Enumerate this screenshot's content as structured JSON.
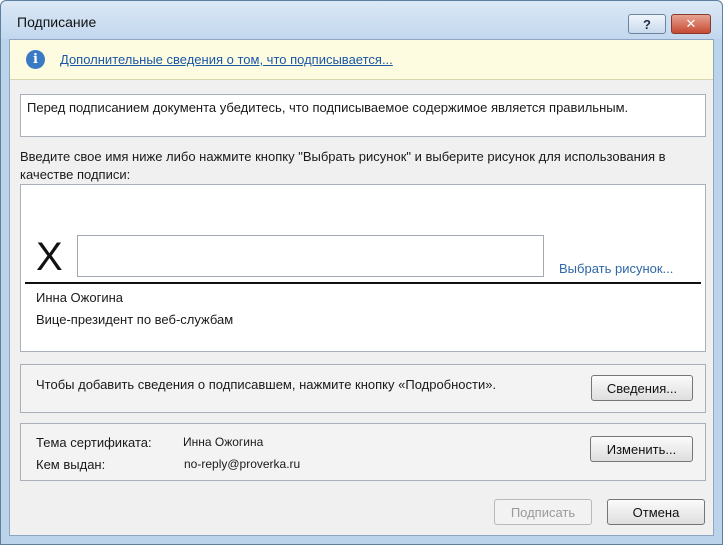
{
  "window": {
    "title": "Подписание",
    "help_label": "?",
    "close_label": "✕"
  },
  "infobar": {
    "icon": "info-icon",
    "icon_glyph": "i",
    "link_text": "Дополнительные сведения о том, что подписывается..."
  },
  "verify_text": "Перед подписанием документа убедитесь, что подписываемое содержимое является правильным.",
  "instruction_text": "Введите свое имя ниже либо нажмите кнопку \"Выбрать рисунок\" и выберите рисунок для использования в качестве подписи:",
  "signature": {
    "x_mark": "X",
    "input_value": "",
    "input_placeholder": "",
    "pick_image_link": "Выбрать рисунок...",
    "signer_name": "Инна Ожогина",
    "signer_title": "Вице-президент по веб-службам"
  },
  "details": {
    "text": "Чтобы добавить сведения о подписавшем, нажмите кнопку «Подробности».",
    "button_label": "Сведения..."
  },
  "certificate": {
    "subject_label": "Тема сертификата:",
    "subject_value": "Инна Ожогина",
    "issuer_label": "Кем выдан:",
    "issuer_value": "no-reply@proverka.ru",
    "change_button_label": "Изменить..."
  },
  "footer": {
    "sign_button_label": "Подписать",
    "cancel_button_label": "Отмена"
  },
  "colors": {
    "link": "#1a56a8",
    "infobar_bg": "#fefce0",
    "window_frame": "#bcd3ec"
  }
}
